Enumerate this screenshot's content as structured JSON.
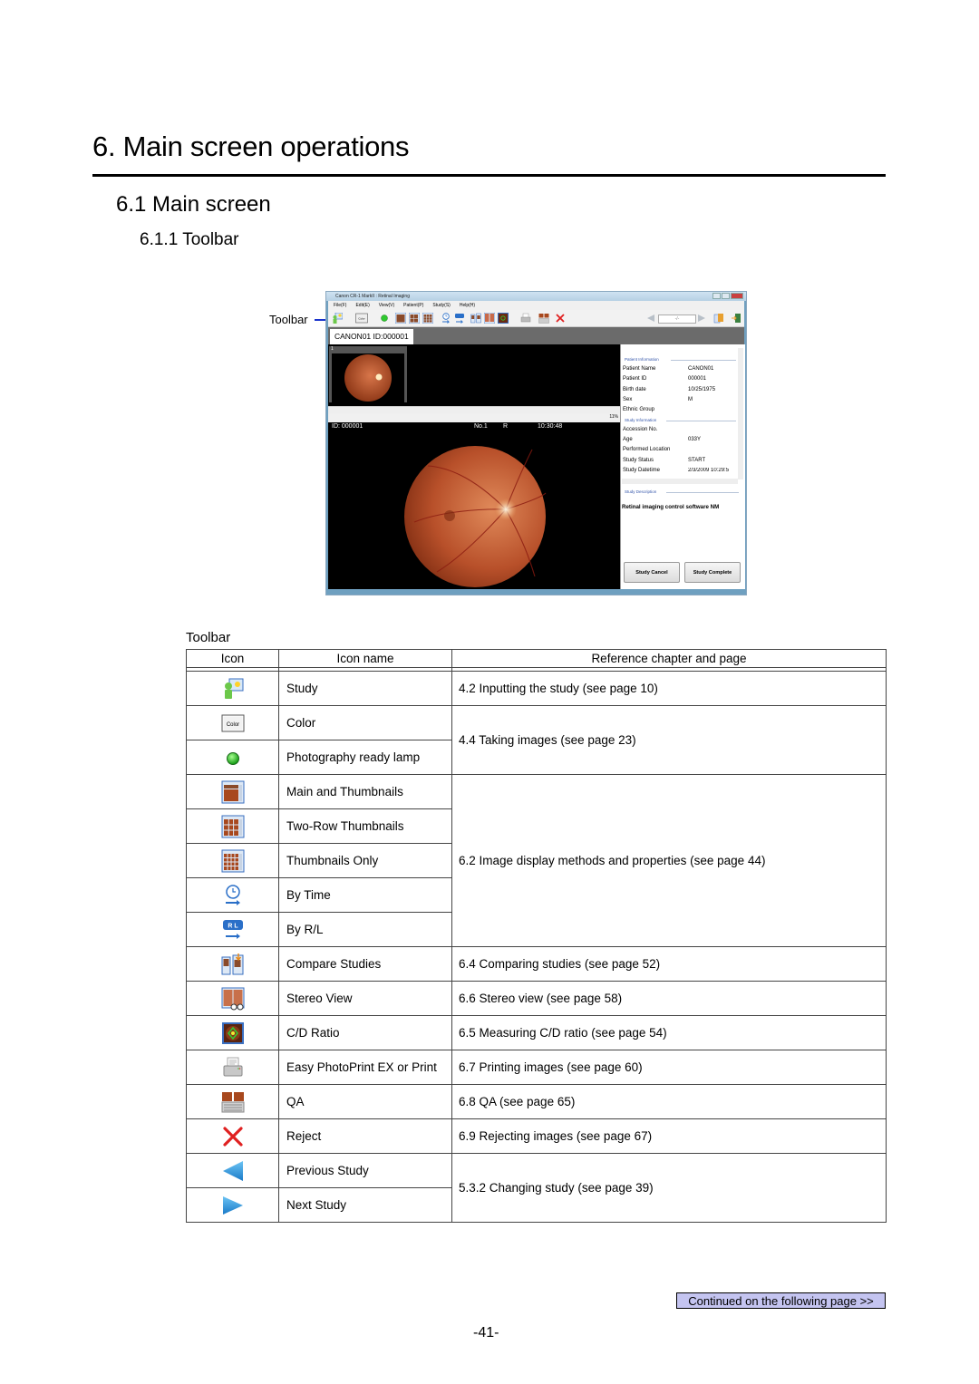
{
  "chapter_title": "6. Main screen operations",
  "section_title": "6.1 Main screen",
  "subsection_title": "6.1.1 Toolbar",
  "screenshot": {
    "callout_label": "Toolbar",
    "window_title": "Canon CR-1 MarkII : Retinal Imaging",
    "menu": [
      "File(F)",
      "Edit(E)",
      "View(V)",
      "Patient(P)",
      "Study(S)",
      "Help(H)"
    ],
    "toolbar_icons": [
      "study-icon",
      "color-icon",
      "ready-lamp-icon",
      "main-and-thumbnails-icon",
      "two-row-thumbnails-icon",
      "thumbnails-only-icon",
      "by-time-icon",
      "by-rl-icon",
      "compare-studies-icon",
      "stereo-view-icon",
      "cd-ratio-icon",
      "print-icon",
      "qa-icon",
      "reject-icon",
      "previous-study-icon",
      "study-counter",
      "next-study-icon",
      "info-icon",
      "exit-icon"
    ],
    "study_counter": "-/-",
    "color_button_label": "Color",
    "tab_label": "CANON01 ID:000001",
    "thumb_index": "1",
    "image_overlay": {
      "id": "ID: 000001",
      "number": "No.1",
      "eye": "R",
      "time": "10:30:48"
    },
    "zoom_level": "11%",
    "patient_info_header": "Patient Information",
    "patient_info": [
      {
        "label": "Patient Name",
        "value": "CANON01"
      },
      {
        "label": "Patient ID",
        "value": "000001"
      },
      {
        "label": "Birth date",
        "value": "10/25/1975"
      },
      {
        "label": "Sex",
        "value": "M"
      },
      {
        "label": "Ethnic Group",
        "value": ""
      }
    ],
    "study_info_header": "Study Information",
    "study_info": [
      {
        "label": "Accession No.",
        "value": ""
      },
      {
        "label": "Age",
        "value": "033Y"
      },
      {
        "label": "Performed Location",
        "value": ""
      },
      {
        "label": "Study Status",
        "value": "START"
      },
      {
        "label": "Study Datetime",
        "value": "2/3/2009 10:29:5"
      }
    ],
    "study_description_header": "Study Description",
    "study_description": "Retinal imaging control software NM",
    "study_cancel_label": "Study Cancel",
    "study_complete_label": "Study Complete"
  },
  "table": {
    "title": "Toolbar",
    "headers": [
      "Icon",
      "Icon name",
      "Reference chapter and page"
    ],
    "rows": [
      {
        "icon": "study-icon",
        "name": "Study",
        "ref": "4.2 Inputting the study (see page 10)"
      },
      {
        "icon": "color-icon",
        "name": "Color",
        "ref": "4.4 Taking images (see page 23)"
      },
      {
        "icon": "ready-lamp-icon",
        "name": "Photography ready lamp",
        "ref": ""
      },
      {
        "icon": "main-and-thumbnails-icon",
        "name": "Main and Thumbnails",
        "ref": "6.2 Image display methods and properties (see page 44)"
      },
      {
        "icon": "two-row-thumbnails-icon",
        "name": "Two-Row Thumbnails",
        "ref": ""
      },
      {
        "icon": "thumbnails-only-icon",
        "name": "Thumbnails Only",
        "ref": ""
      },
      {
        "icon": "by-time-icon",
        "name": "By Time",
        "ref": ""
      },
      {
        "icon": "by-rl-icon",
        "name": "By R/L",
        "ref": ""
      },
      {
        "icon": "compare-studies-icon",
        "name": "Compare Studies",
        "ref": "6.4 Comparing studies (see page 52)"
      },
      {
        "icon": "stereo-view-icon",
        "name": "Stereo View",
        "ref": "6.6 Stereo view (see page 58)"
      },
      {
        "icon": "cd-ratio-icon",
        "name": "C/D Ratio",
        "ref": "6.5 Measuring C/D ratio (see page 54)"
      },
      {
        "icon": "print-icon",
        "name": "Easy PhotoPrint EX or Print",
        "ref": "6.7 Printing images (see page 60)"
      },
      {
        "icon": "qa-icon",
        "name": "QA",
        "ref": "6.8 QA (see page 65)"
      },
      {
        "icon": "reject-icon",
        "name": "Reject",
        "ref": "6.9 Rejecting images (see page 67)"
      },
      {
        "icon": "previous-study-icon",
        "name": "Previous Study",
        "ref": "5.3.2 Changing study (see page 39)"
      },
      {
        "icon": "next-study-icon",
        "name": "Next Study",
        "ref": ""
      }
    ],
    "color_icon_label": "Color",
    "rl_icon_label": "R L"
  },
  "continued_link": "Continued on the following page >>",
  "page_number": "-41-",
  "colors": {
    "reject_red": "#e02020",
    "lamp_green": "#2ec82e",
    "arrow_blue": "#2a9be0",
    "callout_blue": "#1a33cc",
    "continued_bg": "#c4c4f0"
  }
}
